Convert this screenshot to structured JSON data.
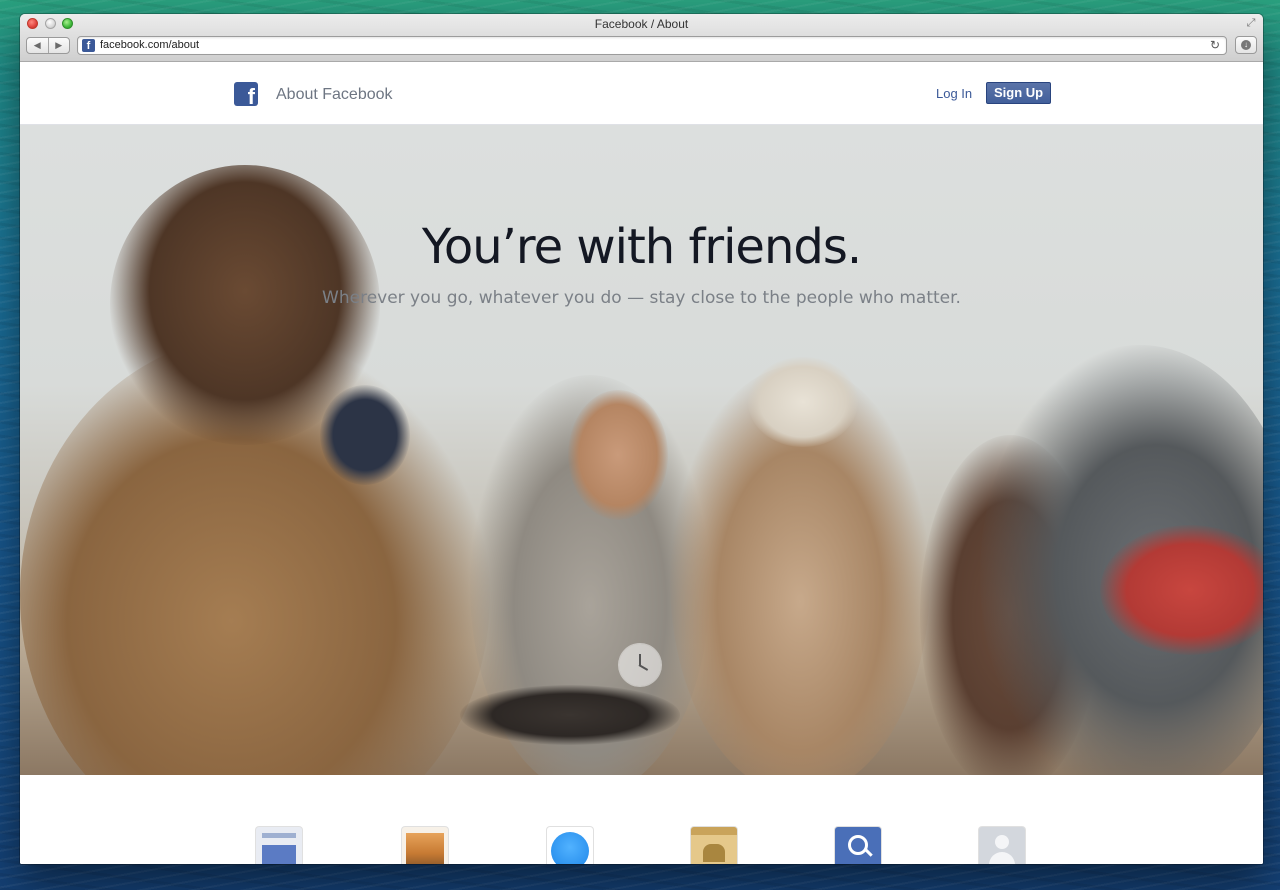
{
  "browser": {
    "window_title": "Facebook / About",
    "url": "facebook.com/about",
    "back_glyph": "◀",
    "forward_glyph": "▶",
    "reload_glyph": "↻",
    "download_glyph": "↓",
    "fullscreen_glyph": "⤢"
  },
  "header": {
    "logo_letter": "f",
    "title": "About Facebook",
    "login_label": "Log In",
    "signup_label": "Sign Up"
  },
  "hero": {
    "headline": "You’re with friends.",
    "subtitle": "Wherever you go, whatever you do — stay close to the people who matter."
  },
  "features": {
    "icons": [
      "newsfeed-icon",
      "photos-icon",
      "messenger-icon",
      "groups-icon",
      "search-icon",
      "profile-icon"
    ]
  },
  "colors": {
    "facebook_blue": "#3b5998",
    "headline": "#141823",
    "subtitle": "#7b8087"
  }
}
